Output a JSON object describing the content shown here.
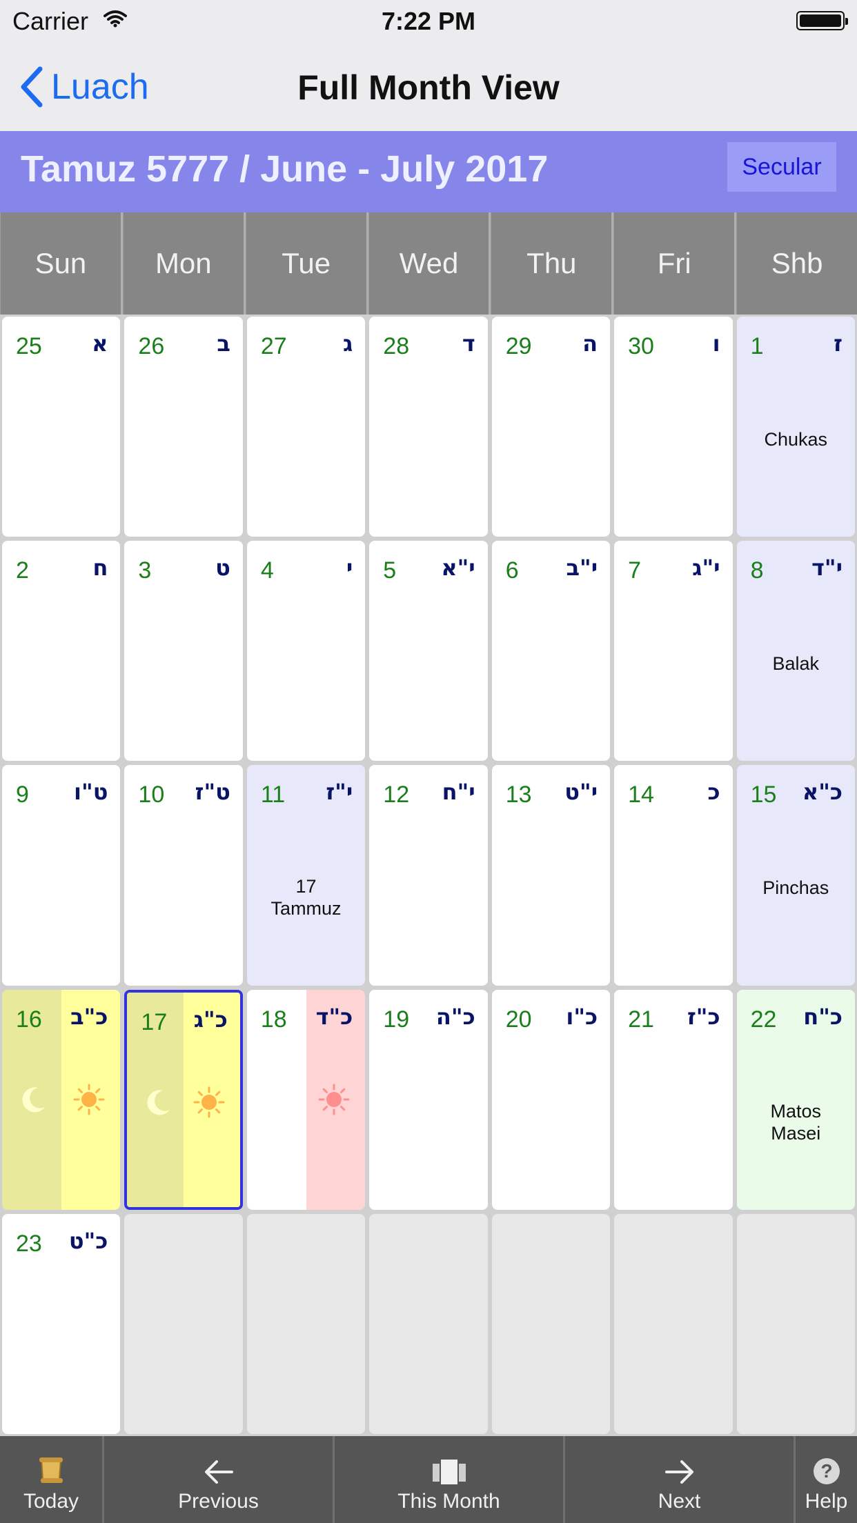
{
  "status_bar": {
    "carrier": "Carrier",
    "time": "7:22 PM"
  },
  "nav": {
    "back_label": "Luach",
    "title": "Full Month View"
  },
  "header": {
    "month_title": "Tamuz 5777 / June - July 2017",
    "toggle_label": "Secular"
  },
  "weekdays": [
    "Sun",
    "Mon",
    "Tue",
    "Wed",
    "Thu",
    "Fri",
    "Shb"
  ],
  "colors": {
    "white": "#ffffff",
    "shabbos": "#e8e8fb",
    "fast": "#e8e8fb",
    "today_dark": "#e9e99b",
    "today_light": "#ffff9c",
    "pink": "#ffd4d4",
    "green": "#eafbea"
  },
  "weeks": [
    [
      {
        "greg": "25",
        "heb": "א",
        "bg": "white"
      },
      {
        "greg": "26",
        "heb": "ב",
        "bg": "white"
      },
      {
        "greg": "27",
        "heb": "ג",
        "bg": "white"
      },
      {
        "greg": "28",
        "heb": "ד",
        "bg": "white"
      },
      {
        "greg": "29",
        "heb": "ה",
        "bg": "white"
      },
      {
        "greg": "30",
        "heb": "ו",
        "bg": "white"
      },
      {
        "greg": "1",
        "heb": "ז",
        "bg": "shabbos",
        "note": "Chukas"
      }
    ],
    [
      {
        "greg": "2",
        "heb": "ח",
        "bg": "white"
      },
      {
        "greg": "3",
        "heb": "ט",
        "bg": "white"
      },
      {
        "greg": "4",
        "heb": "י",
        "bg": "white"
      },
      {
        "greg": "5",
        "heb": "י\"א",
        "bg": "white"
      },
      {
        "greg": "6",
        "heb": "י\"ב",
        "bg": "white"
      },
      {
        "greg": "7",
        "heb": "י\"ג",
        "bg": "white"
      },
      {
        "greg": "8",
        "heb": "י\"ד",
        "bg": "shabbos",
        "note": "Balak"
      }
    ],
    [
      {
        "greg": "9",
        "heb": "ט\"ו",
        "bg": "white"
      },
      {
        "greg": "10",
        "heb": "ט\"ז",
        "bg": "white"
      },
      {
        "greg": "11",
        "heb": "י\"ז",
        "bg": "fast",
        "note": "17\nTammuz"
      },
      {
        "greg": "12",
        "heb": "י\"ח",
        "bg": "white"
      },
      {
        "greg": "13",
        "heb": "י\"ט",
        "bg": "white"
      },
      {
        "greg": "14",
        "heb": "כ",
        "bg": "white"
      },
      {
        "greg": "15",
        "heb": "כ\"א",
        "bg": "shabbos",
        "note": "Pinchas"
      }
    ],
    [
      {
        "greg": "16",
        "heb": "כ\"ב",
        "split": [
          "today_dark",
          "today_light"
        ],
        "icons": [
          "moon",
          "sun"
        ]
      },
      {
        "greg": "17",
        "heb": "כ\"ג",
        "split": [
          "today_dark",
          "today_light"
        ],
        "icons": [
          "moon",
          "sun"
        ],
        "selected": true
      },
      {
        "greg": "18",
        "heb": "כ\"ד",
        "split": [
          "white",
          "pink"
        ],
        "icons": [
          "",
          "sun-red"
        ]
      },
      {
        "greg": "19",
        "heb": "כ\"ה",
        "bg": "white"
      },
      {
        "greg": "20",
        "heb": "כ\"ו",
        "bg": "white"
      },
      {
        "greg": "21",
        "heb": "כ\"ז",
        "bg": "white"
      },
      {
        "greg": "22",
        "heb": "כ\"ח",
        "bg": "green",
        "note": "Matos\nMasei"
      }
    ],
    [
      {
        "greg": "23",
        "heb": "כ\"ט",
        "bg": "white"
      },
      {
        "empty": true
      },
      {
        "empty": true
      },
      {
        "empty": true
      },
      {
        "empty": true
      },
      {
        "empty": true
      },
      {
        "empty": true
      }
    ]
  ],
  "tabbar": {
    "today": "Today",
    "previous": "Previous",
    "this_month": "This Month",
    "next": "Next",
    "help": "Help"
  }
}
